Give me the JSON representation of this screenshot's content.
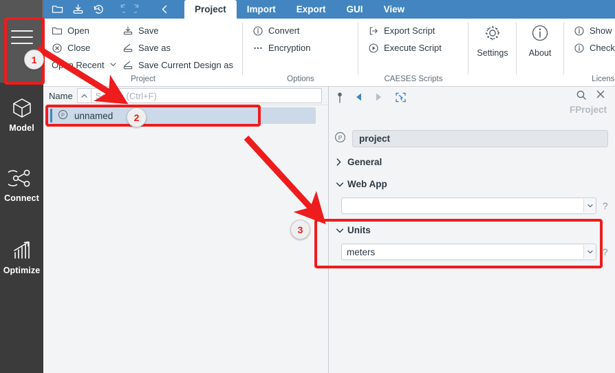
{
  "app": {
    "name": "CAESES",
    "accent_blue": "#4285c0",
    "annotation_red": "#ee1c1c",
    "sidebar_dark": "#3b3b3b"
  },
  "quick_access": [
    {
      "name": "open-folder-icon",
      "label": "Open",
      "enabled": true
    },
    {
      "name": "save-icon",
      "label": "Save",
      "enabled": true
    },
    {
      "name": "history-icon",
      "label": "History",
      "enabled": true
    },
    {
      "name": "undo-icon",
      "label": "Undo",
      "enabled": false
    },
    {
      "name": "redo-icon",
      "label": "Redo",
      "enabled": false
    },
    {
      "name": "collapse-ribbon-icon",
      "label": "Back",
      "enabled": true
    }
  ],
  "tabs": [
    {
      "label": "Project",
      "active": true
    },
    {
      "label": "Import",
      "active": false
    },
    {
      "label": "Export",
      "active": false
    },
    {
      "label": "GUI",
      "active": false
    },
    {
      "label": "View",
      "active": false
    }
  ],
  "ribbon": {
    "groups": [
      {
        "title": "Project",
        "columns": [
          [
            {
              "label": "Open",
              "icon": "folder-icon"
            },
            {
              "label": "Close",
              "icon": "close-circle-icon"
            },
            {
              "label": "Open Recent",
              "icon": "none",
              "dropdown": true
            }
          ],
          [
            {
              "label": "Save",
              "icon": "save-icon"
            },
            {
              "label": "Save as",
              "icon": "save-as-icon"
            },
            {
              "label": "Save Current Design as",
              "icon": "save-as-icon"
            }
          ]
        ]
      },
      {
        "title": "Options",
        "columns": [
          [
            {
              "label": "Convert",
              "icon": "info-circle-icon"
            },
            {
              "label": "Encryption",
              "icon": "dots-icon"
            }
          ]
        ]
      },
      {
        "title": "CAESES Scripts",
        "columns": [
          [
            {
              "label": "Export Script",
              "icon": "export-script-icon"
            },
            {
              "label": "Execute Script",
              "icon": "play-circle-icon"
            }
          ]
        ]
      },
      {
        "title": "",
        "big_buttons": [
          {
            "label": "Settings",
            "icon": "gear-icon"
          },
          {
            "label": "About",
            "icon": "info-circle-icon"
          }
        ]
      },
      {
        "title": "License",
        "columns": [
          [
            {
              "label": "Show Selection at St",
              "icon": "info-circle-icon"
            },
            {
              "label": "Checkout Float Licen",
              "icon": "info-circle-icon"
            }
          ]
        ]
      }
    ]
  },
  "sidebar": {
    "hamburger": {
      "name": "main-menu-icon"
    },
    "items": [
      {
        "label": "Model",
        "icon": "cube-icon"
      },
      {
        "label": "Connect",
        "icon": "network-icon"
      },
      {
        "label": "Optimize",
        "icon": "bar-chart-arrow-icon"
      }
    ]
  },
  "tree": {
    "column_header": "Name",
    "sort_icon": "sort-ascending-icon",
    "search_placeholder": "Search (Ctrl+F)",
    "search_value": "",
    "help_label": "?",
    "rows": [
      {
        "label": "unnamed",
        "icon": "project-p-icon",
        "selected": true
      }
    ]
  },
  "properties": {
    "toolbar_left": [
      {
        "name": "pin-icon"
      },
      {
        "name": "back-arrow-icon"
      },
      {
        "name": "forward-arrow-icon"
      },
      {
        "name": "select-target-icon"
      }
    ],
    "toolbar_right": [
      {
        "name": "search-icon"
      },
      {
        "name": "close-icon"
      }
    ],
    "type_label": "FProject",
    "name_field": {
      "icon": "project-p-icon",
      "value": "project"
    },
    "sections": [
      {
        "label": "General",
        "expanded": false
      },
      {
        "label": "Web App",
        "expanded": true
      },
      {
        "label": "Units",
        "expanded": true
      }
    ],
    "web_app_combo": {
      "value": "",
      "help": "?"
    },
    "units_combo": {
      "value": "meters",
      "help": "?"
    }
  },
  "annotations": {
    "badges": [
      {
        "number": "1",
        "target": "main-menu-button"
      },
      {
        "number": "2",
        "target": "project-tree-item"
      },
      {
        "number": "3",
        "target": "units-section"
      }
    ]
  }
}
